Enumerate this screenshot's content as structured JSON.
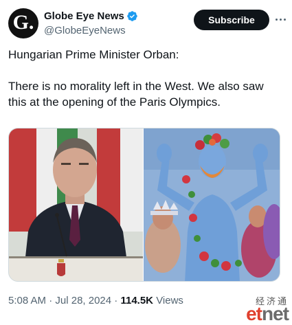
{
  "account": {
    "display_name": "Globe Eye News",
    "handle": "@GlobeEyeNews",
    "avatar_letter": "G.",
    "verified_icon": "verified-badge-icon",
    "verified_color": "#1d9bf0"
  },
  "actions": {
    "subscribe_label": "Subscribe",
    "more_icon": "more-dots-icon"
  },
  "tweet": {
    "line1": "Hungarian Prime Minister Orban:",
    "line2": "There is no morality left in the West.  We also saw this at the opening of the Paris Olympics."
  },
  "media": {
    "left_alt_icon": "photo-speaker-at-podium",
    "right_alt_icon": "photo-olympics-performer"
  },
  "meta": {
    "time": "5:08 AM",
    "sep1": "·",
    "date": "Jul 28, 2024",
    "sep2": "·",
    "views_count": "114.5K",
    "views_label": "Views"
  },
  "watermark": {
    "cn_text": "经济通",
    "logo_et": "et",
    "logo_net": "net"
  },
  "colors": {
    "text": "#0f1419",
    "secondary": "#536471",
    "border": "#cfd9de",
    "subscribe_bg": "#0f1419"
  }
}
